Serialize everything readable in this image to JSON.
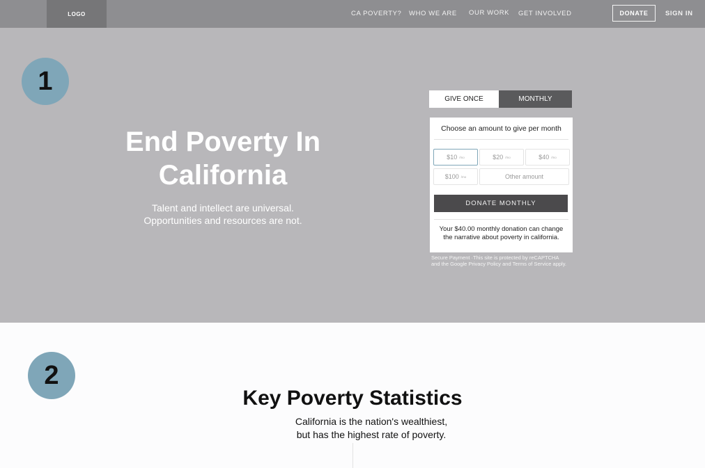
{
  "nav": {
    "logo": "LOGO",
    "links": [
      "CA POVERTY?",
      "WHO WE ARE",
      "OUR WORK",
      "GET INVOLVED"
    ],
    "donate": "DONATE",
    "sign_in": "SIGN IN"
  },
  "hero": {
    "badge": "1",
    "title": "End Poverty In California",
    "subtitle_line1": "Talent and intellect are universal.",
    "subtitle_line2": "Opportunities and resources are not."
  },
  "donation": {
    "tabs": [
      "GIVE ONCE",
      "MONTHLY"
    ],
    "active_tab": "MONTHLY",
    "heading": "Choose an amount to give per month",
    "amounts": [
      "$10",
      "$20",
      "$40",
      "$100"
    ],
    "per_suffix": "/mo",
    "selected_amount": "$10",
    "other_amount": "Other amount",
    "button": "DONATE MONTHLY",
    "impact_line1": "Your $40.00 monthly donation can change",
    "impact_line2": "the narrative about poverty in california.",
    "secure_line1": "Secure Payment ·This site is protected by reCAPTCHA",
    "secure_line2": "and the Google Privacy Policy and Terms of Service apply."
  },
  "stats": {
    "badge": "2",
    "title": "Key Poverty Statistics",
    "subtitle_line1": "California  is the nation's wealthiest,",
    "subtitle_line2": "but has the highest rate of poverty."
  },
  "colors": {
    "hero_bg": "#b8b7ba",
    "nav_bg": "#8e8e91",
    "badge": "#7fa6b8",
    "button_dark": "#4b4a4c"
  }
}
